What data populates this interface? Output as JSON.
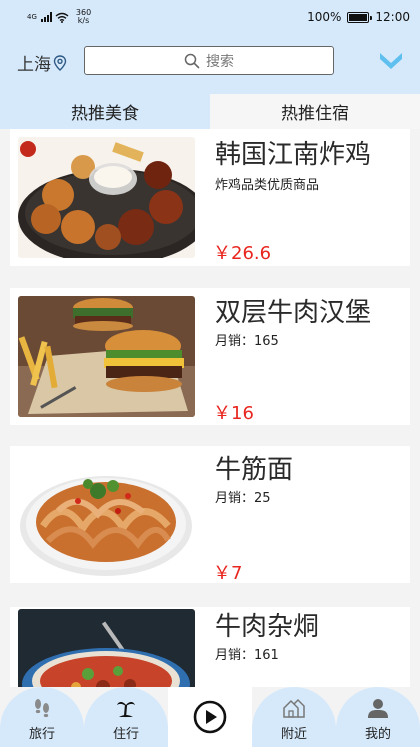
{
  "status": {
    "net": "4G",
    "speed_top": "360",
    "speed_bottom": "k/s",
    "battery": "100%",
    "time": "12:00"
  },
  "header": {
    "city": "上海",
    "search_placeholder": "搜索"
  },
  "tabs": [
    {
      "label": "热推美食"
    },
    {
      "label": "热推住宿"
    }
  ],
  "items": [
    {
      "name": "韩国江南炸鸡",
      "sub": "炸鸡品类优质商品",
      "price": "￥26.6"
    },
    {
      "name": "双层牛肉汉堡",
      "sub": "月销：165",
      "price": "￥16"
    },
    {
      "name": "牛筋面",
      "sub": "月销：25",
      "price": "￥7"
    },
    {
      "name": "牛肉杂烔",
      "sub": "月销：161",
      "price": ""
    }
  ],
  "nav": [
    {
      "label": "旅行"
    },
    {
      "label": "住行"
    },
    {
      "label": "附近"
    },
    {
      "label": "我的"
    }
  ],
  "colors": {
    "header_bg": "#d6e9fb",
    "price": "#e8261f",
    "accent": "#5fc0f0"
  }
}
